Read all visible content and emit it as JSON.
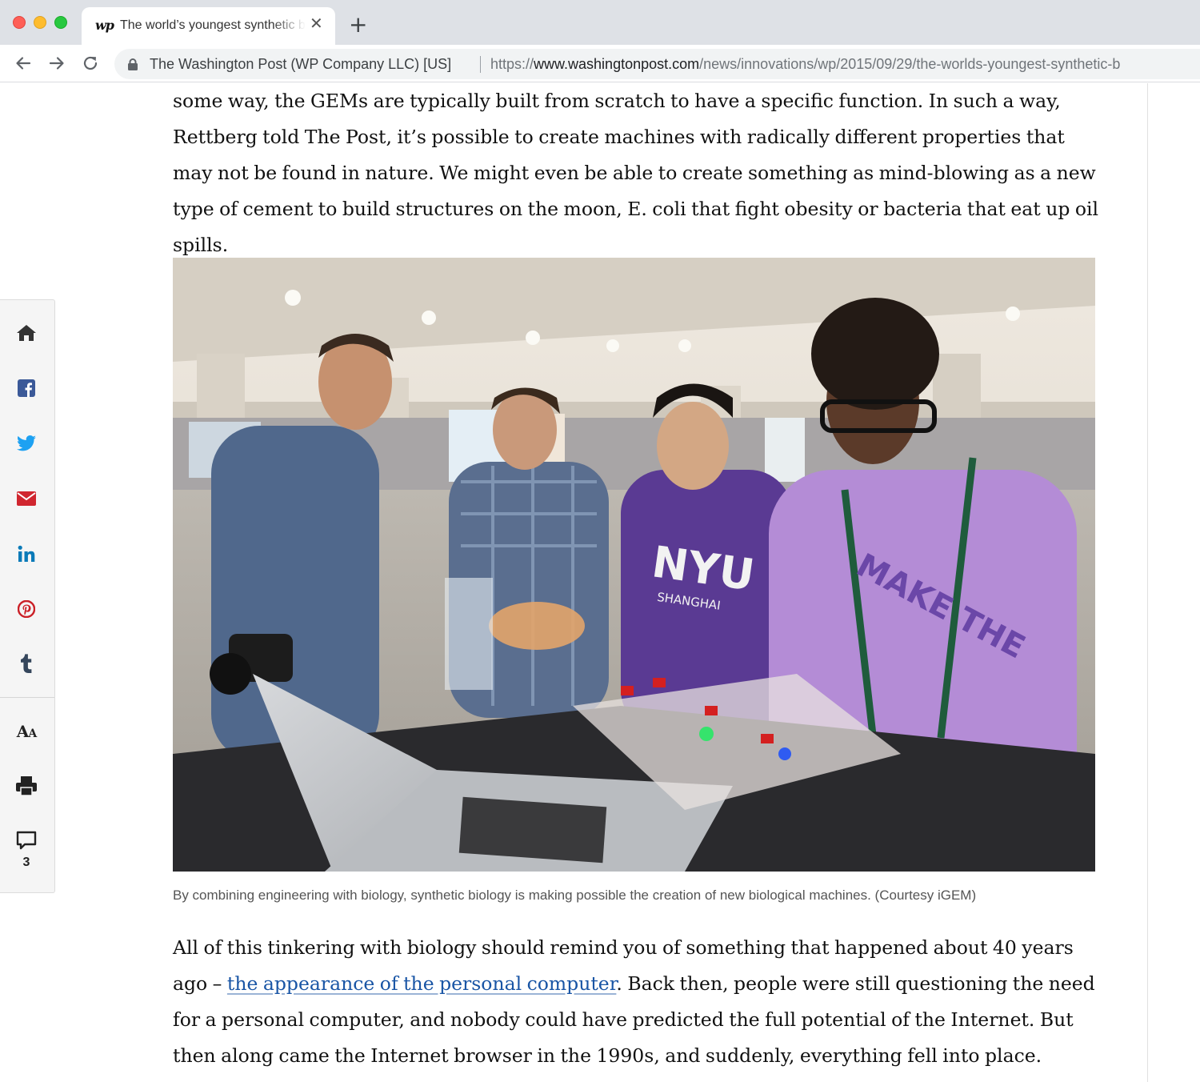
{
  "browser": {
    "tab": {
      "favicon_text": "wp",
      "title": "The world’s youngest synthetic biologists",
      "close_glyph": "✕"
    },
    "new_tab_glyph": "+",
    "address_bar": {
      "ev_certificate": "The Washington Post (WP Company LLC) [US]",
      "url_scheme": "https://",
      "url_host": "www.washingtonpost.com",
      "url_path": "/news/innovations/wp/2015/09/29/the-worlds-youngest-synthetic-b"
    },
    "icons": [
      "back-arrow-icon",
      "forward-arrow-icon",
      "reload-icon",
      "lock-icon"
    ]
  },
  "article": {
    "paragraph_1": "some way, the GEMs are typically built from scratch to have a specific function. In such a way, Rettberg told The Post, it’s possible to create machines with radically different properties that may not be found in nature. We might even be able to create something as mind-blowing as a new type of cement to build structures on the moon, E. coli that fight obesity or bacteria that eat up oil spills.",
    "photo": {
      "subject": "photo-igem-team-with-device",
      "shirt_text_1": "MAKE THE WORLD YOUR",
      "shirt_text_2": "NYU SHANGHAI"
    },
    "caption": "By combining engineering with biology, synthetic biology is making possible the creation of new biological machines. (Courtesy iGEM)",
    "paragraph_2_before_link": "All of this tinkering with biology should remind you of something that happened about 40 years ago – ",
    "paragraph_2_link": "the appearance of the personal computer",
    "paragraph_2_after_link": ". Back then, people were still questioning the need for a personal computer, and nobody could have predicted the full potential of the Internet. But then along came the Internet browser in the 1990s, and suddenly, everything fell into place."
  },
  "share_rail": {
    "items": [
      {
        "name": "home",
        "icon": "home-icon"
      },
      {
        "name": "facebook",
        "icon": "facebook-icon",
        "color": "#3b5998"
      },
      {
        "name": "twitter",
        "icon": "twitter-icon",
        "color": "#1da1f2"
      },
      {
        "name": "email",
        "icon": "email-icon",
        "color": "#d0262f"
      },
      {
        "name": "linkedin",
        "icon": "linkedin-icon",
        "color": "#0a7ab8"
      },
      {
        "name": "pinterest",
        "icon": "pinterest-icon",
        "color": "#cb2027"
      },
      {
        "name": "tumblr",
        "icon": "tumblr-icon",
        "color": "#35465c"
      }
    ],
    "text_size_label": "A",
    "text_size_label_small": "A",
    "print_icon": "print-icon",
    "comments_icon": "comment-icon",
    "comments_count": "3"
  }
}
